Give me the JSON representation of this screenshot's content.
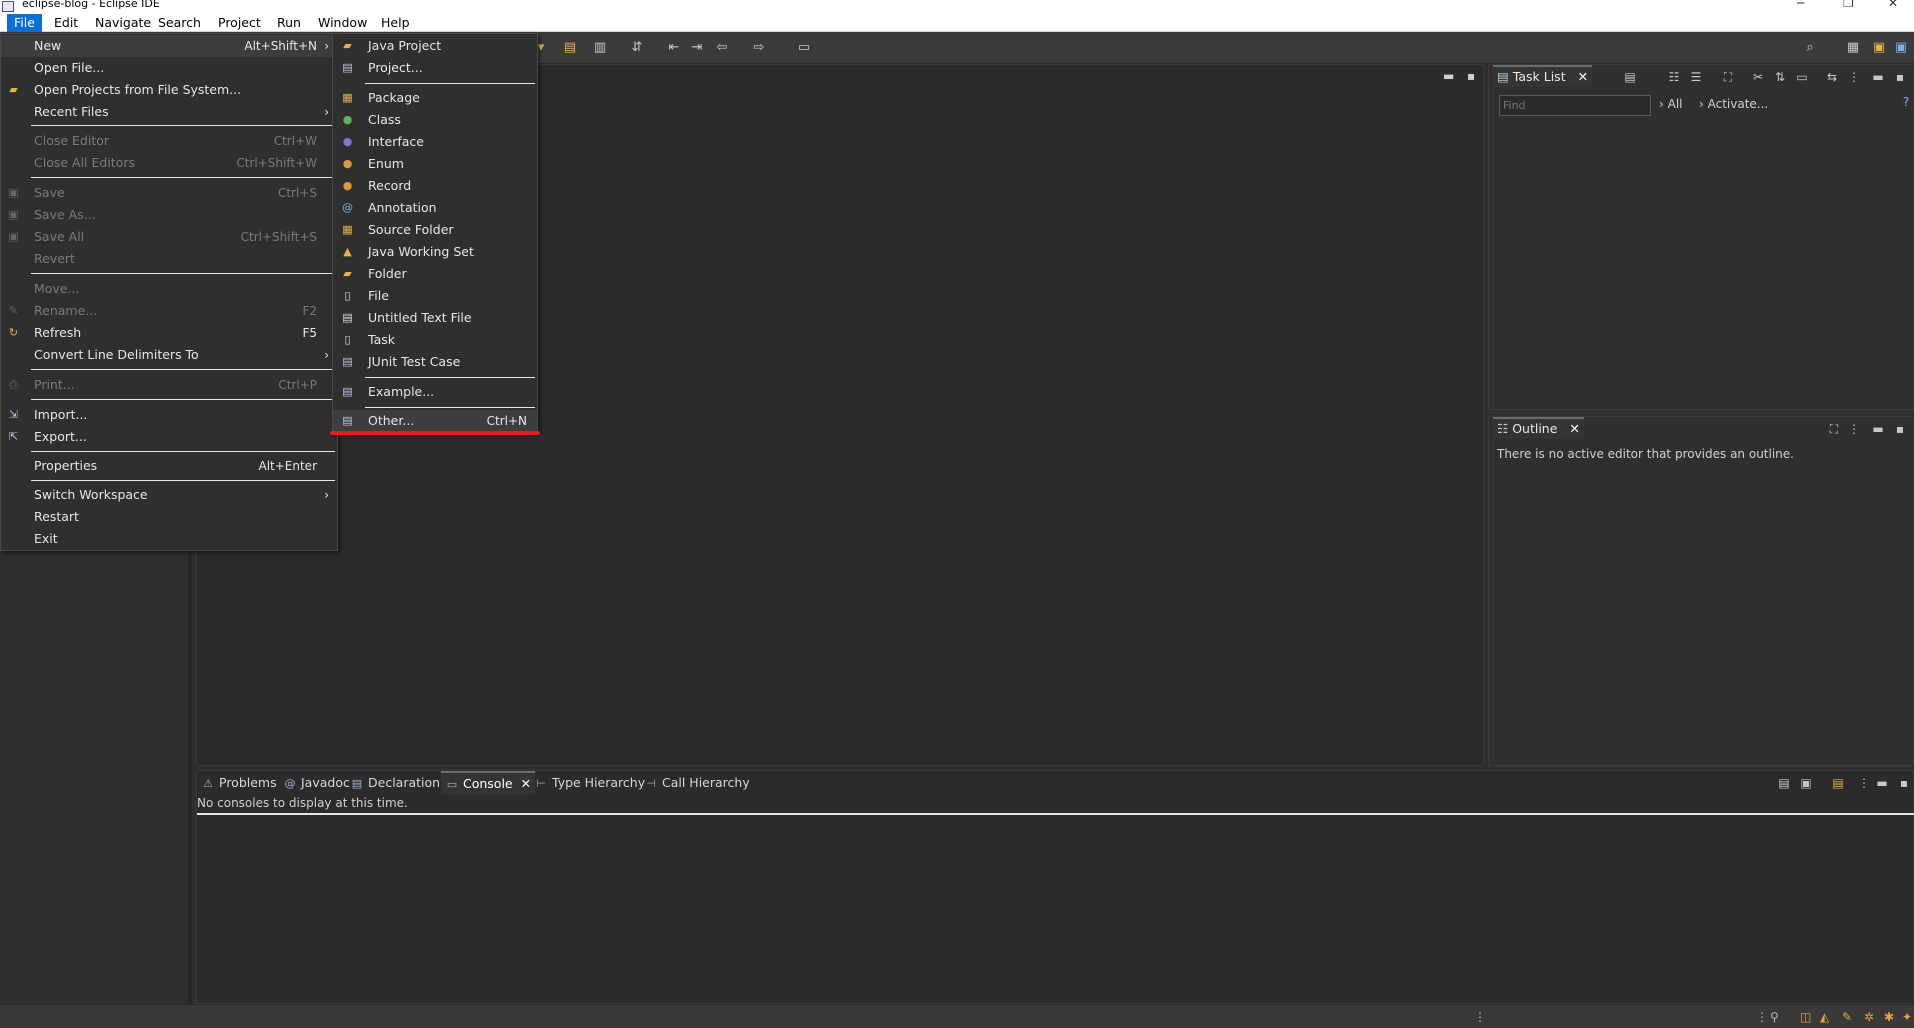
{
  "window": {
    "title": "eclipse-blog - Eclipse IDE"
  },
  "menubar": [
    "File",
    "Edit",
    "Navigate",
    "Search",
    "Project",
    "Run",
    "Window",
    "Help"
  ],
  "file_menu": [
    {
      "label": "New",
      "accel": "Alt+Shift+N",
      "submenu": true,
      "icon": "new-icon"
    },
    {
      "label": "Open File...",
      "accel": "",
      "icon": ""
    },
    {
      "label": "Open Projects from File System...",
      "accel": "",
      "icon": "folder-open-icon"
    },
    {
      "label": "Recent Files",
      "accel": "",
      "submenu": true,
      "icon": ""
    },
    {
      "label": "Close Editor",
      "accel": "Ctrl+W",
      "disabled": true,
      "icon": ""
    },
    {
      "label": "Close All Editors",
      "accel": "Ctrl+Shift+W",
      "disabled": true,
      "icon": ""
    },
    {
      "label": "Save",
      "accel": "Ctrl+S",
      "disabled": true,
      "icon": "save-icon"
    },
    {
      "label": "Save As...",
      "accel": "",
      "disabled": true,
      "icon": "save-as-icon"
    },
    {
      "label": "Save All",
      "accel": "Ctrl+Shift+S",
      "disabled": true,
      "icon": "save-all-icon"
    },
    {
      "label": "Revert",
      "accel": "",
      "disabled": true,
      "icon": ""
    },
    {
      "label": "Move...",
      "accel": "",
      "disabled": true,
      "icon": ""
    },
    {
      "label": "Rename...",
      "accel": "F2",
      "disabled": true,
      "icon": "rename-icon"
    },
    {
      "label": "Refresh",
      "accel": "F5",
      "icon": "refresh-icon"
    },
    {
      "label": "Convert Line Delimiters To",
      "accel": "",
      "submenu": true,
      "icon": ""
    },
    {
      "label": "Print...",
      "accel": "Ctrl+P",
      "disabled": true,
      "icon": "print-icon"
    },
    {
      "label": "Import...",
      "accel": "",
      "icon": "import-icon"
    },
    {
      "label": "Export...",
      "accel": "",
      "icon": "export-icon"
    },
    {
      "label": "Properties",
      "accel": "Alt+Enter",
      "icon": ""
    },
    {
      "label": "Switch Workspace",
      "accel": "",
      "submenu": true,
      "icon": ""
    },
    {
      "label": "Restart",
      "accel": "",
      "icon": ""
    },
    {
      "label": "Exit",
      "accel": "",
      "icon": ""
    }
  ],
  "new_menu": [
    {
      "label": "Java Project",
      "accel": "",
      "icon": "java-project-icon"
    },
    {
      "label": "Project...",
      "accel": "",
      "icon": "project-icon"
    },
    {
      "label": "Package",
      "accel": "",
      "icon": "package-icon"
    },
    {
      "label": "Class",
      "accel": "",
      "icon": "class-icon"
    },
    {
      "label": "Interface",
      "accel": "",
      "icon": "interface-icon"
    },
    {
      "label": "Enum",
      "accel": "",
      "icon": "enum-icon"
    },
    {
      "label": "Record",
      "accel": "",
      "icon": "record-icon"
    },
    {
      "label": "Annotation",
      "accel": "",
      "icon": "annotation-icon"
    },
    {
      "label": "Source Folder",
      "accel": "",
      "icon": "source-folder-icon"
    },
    {
      "label": "Java Working Set",
      "accel": "",
      "icon": "working-set-icon"
    },
    {
      "label": "Folder",
      "accel": "",
      "icon": "folder-icon"
    },
    {
      "label": "File",
      "accel": "",
      "icon": "file-icon"
    },
    {
      "label": "Untitled Text File",
      "accel": "",
      "icon": "text-file-icon"
    },
    {
      "label": "Task",
      "accel": "",
      "icon": "task-icon"
    },
    {
      "label": "JUnit Test Case",
      "accel": "",
      "icon": "junit-icon"
    },
    {
      "label": "Example...",
      "accel": "",
      "icon": "example-icon"
    },
    {
      "label": "Other...",
      "accel": "Ctrl+N",
      "icon": "other-icon"
    }
  ],
  "tasklist": {
    "tab": "Task List",
    "find_placeholder": "Find",
    "all_label": "All",
    "activate_label": "Activate..."
  },
  "outline": {
    "tab": "Outline",
    "message": "There is no active editor that provides an outline."
  },
  "bottom_tabs": [
    "Problems",
    "Javadoc",
    "Declaration",
    "Console",
    "Type Hierarchy",
    "Call Hierarchy"
  ],
  "console": {
    "message": "No consoles to display at this time."
  },
  "colors": {
    "menu_highlight": "#0a70d7",
    "annotation_red": "#e51c23"
  }
}
